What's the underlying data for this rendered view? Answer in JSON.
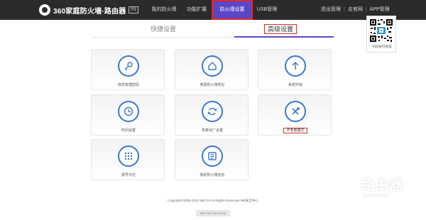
{
  "header": {
    "brand": "360家庭防火墙·路由器",
    "model": "P3",
    "nav": [
      "我的防火墙",
      "功能扩展",
      "防火墙设置",
      "USB管理"
    ],
    "active_nav": "防火墙设置",
    "right_links": [
      "退出管理",
      "去官网",
      "APP管理"
    ]
  },
  "qr": {
    "caption": "扫码即可管理"
  },
  "tabs": {
    "quick": "快捷设置",
    "advanced": "高级设置"
  },
  "cards": [
    {
      "label": "修改管理密码",
      "icon": "key-icon"
    },
    {
      "label": "修改防火墙地址",
      "icon": "home-icon"
    },
    {
      "label": "系统升级",
      "icon": "upload-arrow-icon"
    },
    {
      "label": "时间设置",
      "icon": "clock-icon"
    },
    {
      "label": "恢复出厂设置",
      "icon": "restore-icon"
    },
    {
      "label": "开发者模式",
      "icon": "tools-icon"
    },
    {
      "label": "拨号日志",
      "icon": "dialpad-icon"
    },
    {
      "label": "我的防火墙信息",
      "icon": "info-document-icon"
    }
  ],
  "footer": {
    "copyright": "Copyright©2005-2020 360.CN All Rights Reserved 360安全中心",
    "button": "360 OS For Home"
  },
  "watermark": {
    "title": "路由器",
    "subtitle": "luyouqi.com"
  },
  "colors": {
    "topbar": "#2b2b2b",
    "accent": "#5b46c8",
    "icon_blue": "#3a78c9",
    "highlight": "#e02a2a"
  }
}
